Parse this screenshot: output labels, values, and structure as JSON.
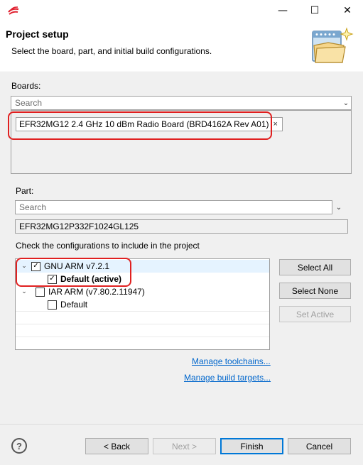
{
  "window": {
    "min_glyph": "—",
    "max_glyph": "☐",
    "close_glyph": "✕"
  },
  "header": {
    "title": "Project setup",
    "subtitle": "Select the board, part, and initial build configurations.",
    "icon": "project-wizard-icon"
  },
  "boards": {
    "label": "Boards:",
    "search_placeholder": "Search",
    "selected_chip": "EFR32MG12 2.4 GHz 10 dBm Radio Board (BRD4162A Rev A01)",
    "chip_remove_glyph": "×"
  },
  "part": {
    "label": "Part:",
    "search_placeholder": "Search",
    "selected_value": "EFR32MG12P332F1024GL125"
  },
  "configs": {
    "label": "Check the configurations to include in the project",
    "tree": [
      {
        "label": "GNU ARM v7.2.1",
        "checked": true,
        "expanded": true,
        "level": 0
      },
      {
        "label": "Default (active)",
        "checked": true,
        "bold": true,
        "level": 1
      },
      {
        "label": "IAR ARM (v7.80.2.11947)",
        "checked": false,
        "expanded": true,
        "level": 0
      },
      {
        "label": "Default",
        "checked": false,
        "level": 1
      }
    ],
    "select_all": "Select All",
    "select_none": "Select None",
    "set_active": "Set Active"
  },
  "links": {
    "toolchains": "Manage toolchains...",
    "build_targets": "Manage build targets..."
  },
  "footer": {
    "help": "?",
    "back": "< Back",
    "next": "Next >",
    "finish": "Finish",
    "cancel": "Cancel"
  },
  "colors": {
    "highlight": "#e02020",
    "link": "#0066cc",
    "default_button_border": "#0078d7"
  }
}
